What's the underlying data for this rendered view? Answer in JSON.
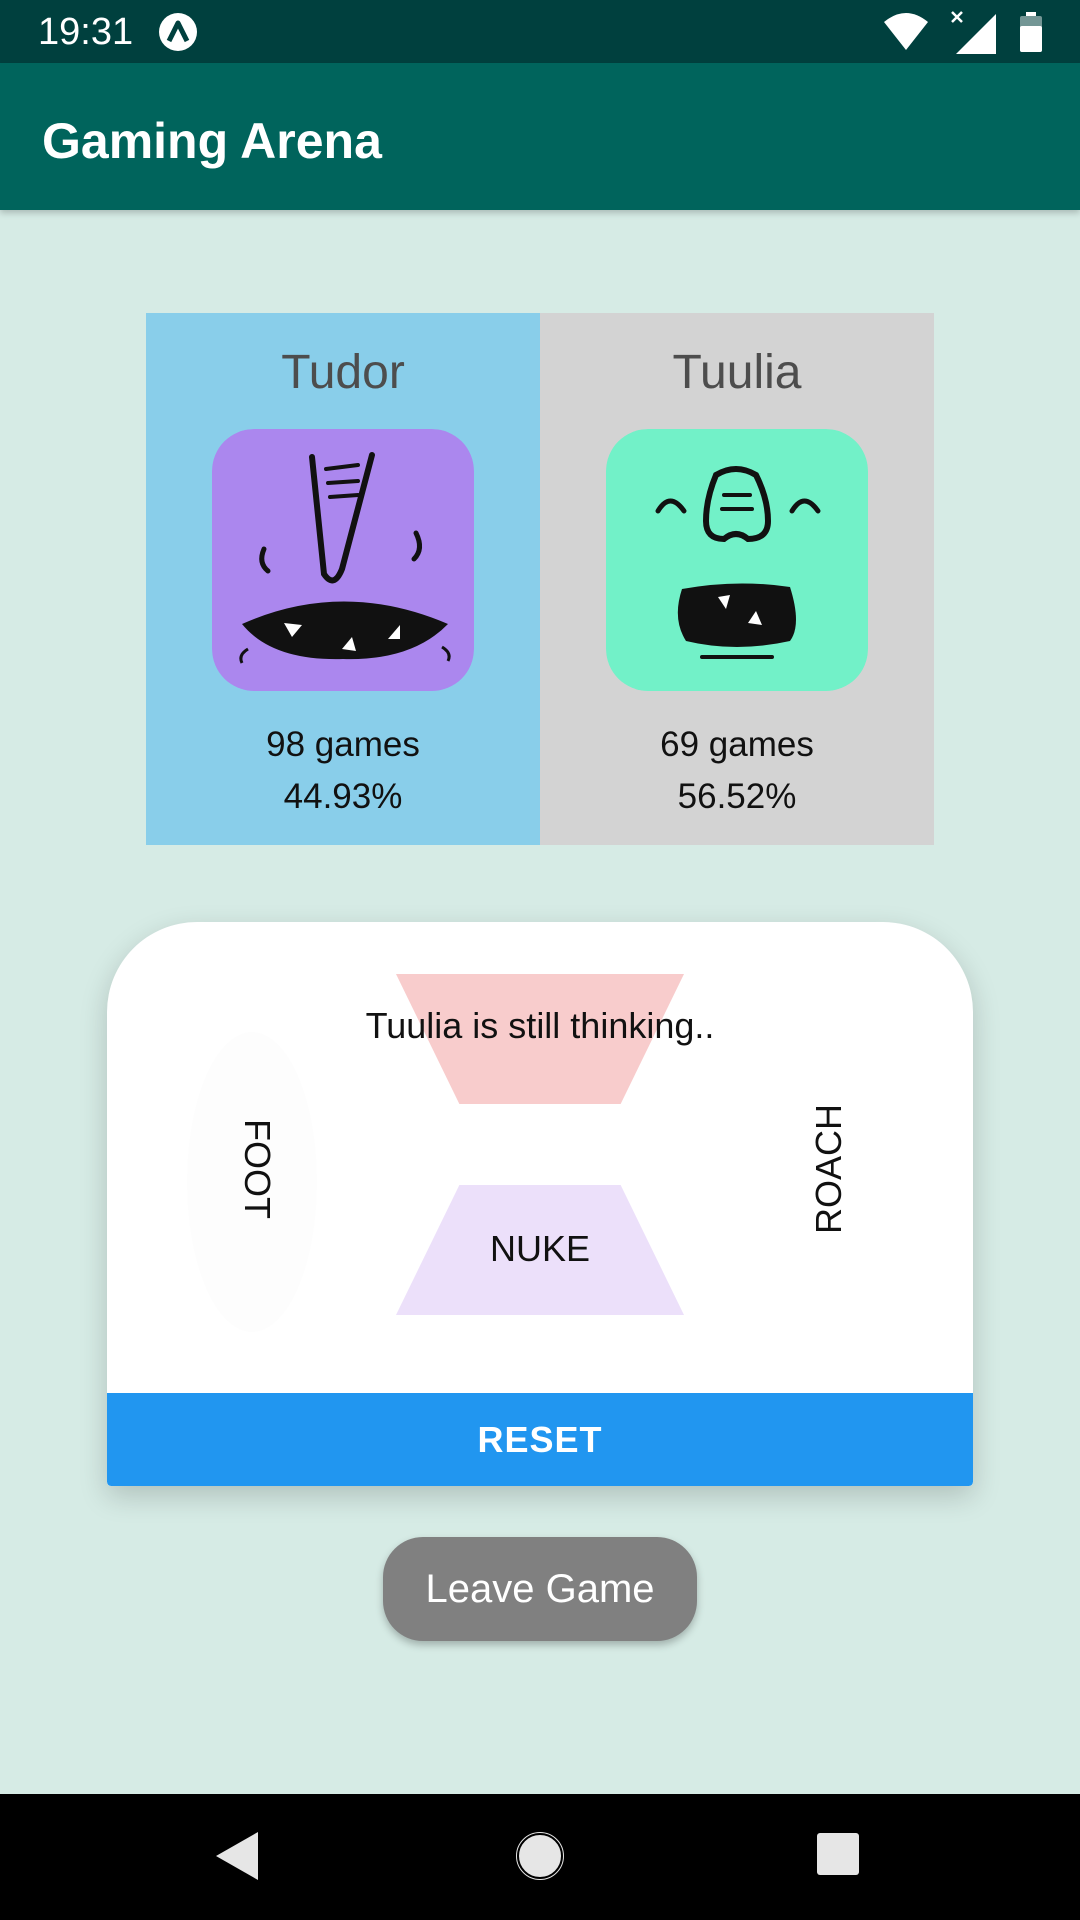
{
  "status_bar": {
    "time": "19:31",
    "icons": [
      "app-notification-icon",
      "wifi-icon",
      "signal-icon",
      "battery-icon"
    ]
  },
  "app_bar": {
    "title": "Gaming Arena",
    "color": "#00645c"
  },
  "players": [
    {
      "name": "Tudor",
      "games": "98 games",
      "win_pct": "44.93%",
      "panel_color": "#89ceea",
      "avatar_color": "#ab87ee",
      "avatar": "purple-monster-avatar"
    },
    {
      "name": "Tuulia",
      "games": "69 games",
      "win_pct": "56.52%",
      "panel_color": "#d3d3d3",
      "avatar_color": "#72f1c8",
      "avatar": "green-monster-avatar"
    }
  ],
  "game": {
    "status": "Tuulia is still thinking..",
    "choices": {
      "left": "FOOT",
      "bottom": "NUKE",
      "right": "ROACH"
    },
    "reset_label": "RESET",
    "reset_color": "#2196f0"
  },
  "leave_label": "Leave Game",
  "nav_bar": [
    "back-icon",
    "home-icon",
    "recents-icon"
  ]
}
